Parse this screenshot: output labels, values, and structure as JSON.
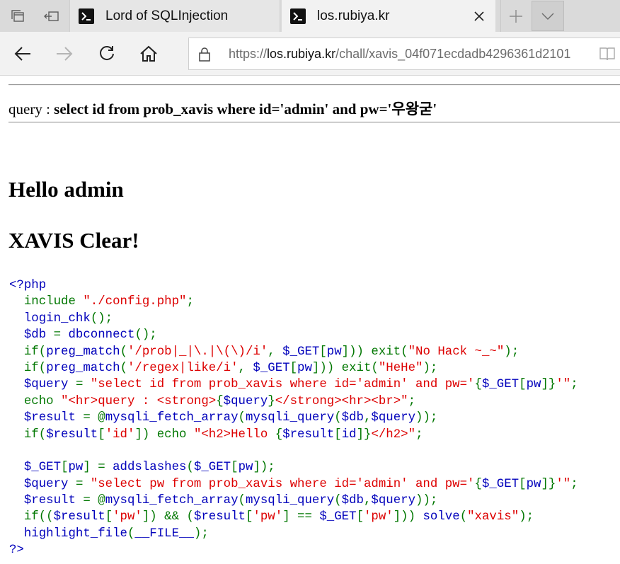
{
  "browser": {
    "tabs": [
      {
        "title": "Lord of SQLInjection",
        "active": false,
        "icon": "terminal-icon"
      },
      {
        "title": "los.rubiya.kr",
        "active": true,
        "icon": "terminal-icon"
      }
    ],
    "address": {
      "scheme": "https://",
      "host": "los.rubiya.kr",
      "path": "/chall/xavis_04f071ecdadb4296361d2101"
    }
  },
  "page": {
    "query_label": "query : ",
    "query_text": "select id from prob_xavis where id='admin' and pw='우왕굳'",
    "hello": "Hello admin",
    "clear": "XAVIS Clear!"
  },
  "colors": {
    "php_default": "#0000bb",
    "php_keyword": "#007700",
    "php_string": "#dd0000"
  },
  "source_code": [
    [
      [
        "d",
        "<?php"
      ]
    ],
    [
      [
        "k",
        "  include "
      ],
      [
        "s",
        "\"./config.php\""
      ],
      [
        "k",
        ";"
      ]
    ],
    [
      [
        "d",
        "  login_chk"
      ],
      [
        "k",
        "();"
      ]
    ],
    [
      [
        "d",
        "  $db "
      ],
      [
        "k",
        "= "
      ],
      [
        "d",
        "dbconnect"
      ],
      [
        "k",
        "();"
      ]
    ],
    [
      [
        "k",
        "  if("
      ],
      [
        "d",
        "preg_match"
      ],
      [
        "k",
        "("
      ],
      [
        "s",
        "'/prob|_|\\.|\\(\\)/i'"
      ],
      [
        "k",
        ", "
      ],
      [
        "d",
        "$_GET"
      ],
      [
        "k",
        "["
      ],
      [
        "d",
        "pw"
      ],
      [
        "k",
        "])) exit("
      ],
      [
        "s",
        "\"No Hack ~_~\""
      ],
      [
        "k",
        ");"
      ]
    ],
    [
      [
        "k",
        "  if("
      ],
      [
        "d",
        "preg_match"
      ],
      [
        "k",
        "("
      ],
      [
        "s",
        "'/regex|like/i'"
      ],
      [
        "k",
        ", "
      ],
      [
        "d",
        "$_GET"
      ],
      [
        "k",
        "["
      ],
      [
        "d",
        "pw"
      ],
      [
        "k",
        "])) exit("
      ],
      [
        "s",
        "\"HeHe\""
      ],
      [
        "k",
        ");"
      ]
    ],
    [
      [
        "d",
        "  $query "
      ],
      [
        "k",
        "= "
      ],
      [
        "s",
        "\"select id from prob_xavis where id='admin' and pw='"
      ],
      [
        "k",
        "{"
      ],
      [
        "d",
        "$_GET"
      ],
      [
        "k",
        "["
      ],
      [
        "d",
        "pw"
      ],
      [
        "k",
        "]}"
      ],
      [
        "s",
        "'\""
      ],
      [
        "k",
        ";"
      ]
    ],
    [
      [
        "k",
        "  echo "
      ],
      [
        "s",
        "\"<hr>query : <strong>"
      ],
      [
        "k",
        "{"
      ],
      [
        "d",
        "$query"
      ],
      [
        "k",
        "}"
      ],
      [
        "s",
        "</strong><hr><br>\""
      ],
      [
        "k",
        ";"
      ]
    ],
    [
      [
        "d",
        "  $result "
      ],
      [
        "k",
        "= @"
      ],
      [
        "d",
        "mysqli_fetch_array"
      ],
      [
        "k",
        "("
      ],
      [
        "d",
        "mysqli_query"
      ],
      [
        "k",
        "("
      ],
      [
        "d",
        "$db"
      ],
      [
        "k",
        ","
      ],
      [
        "d",
        "$query"
      ],
      [
        "k",
        "));"
      ]
    ],
    [
      [
        "k",
        "  if("
      ],
      [
        "d",
        "$result"
      ],
      [
        "k",
        "["
      ],
      [
        "s",
        "'id'"
      ],
      [
        "k",
        "]) echo "
      ],
      [
        "s",
        "\"<h2>Hello "
      ],
      [
        "k",
        "{"
      ],
      [
        "d",
        "$result"
      ],
      [
        "k",
        "["
      ],
      [
        "d",
        "id"
      ],
      [
        "k",
        "]}"
      ],
      [
        "s",
        "</h2>\""
      ],
      [
        "k",
        ";"
      ]
    ],
    [
      [
        "d",
        ""
      ]
    ],
    [
      [
        "d",
        "  $_GET"
      ],
      [
        "k",
        "["
      ],
      [
        "d",
        "pw"
      ],
      [
        "k",
        "] = "
      ],
      [
        "d",
        "addslashes"
      ],
      [
        "k",
        "("
      ],
      [
        "d",
        "$_GET"
      ],
      [
        "k",
        "["
      ],
      [
        "d",
        "pw"
      ],
      [
        "k",
        "]);"
      ]
    ],
    [
      [
        "d",
        "  $query "
      ],
      [
        "k",
        "= "
      ],
      [
        "s",
        "\"select pw from prob_xavis where id='admin' and pw='"
      ],
      [
        "k",
        "{"
      ],
      [
        "d",
        "$_GET"
      ],
      [
        "k",
        "["
      ],
      [
        "d",
        "pw"
      ],
      [
        "k",
        "]}"
      ],
      [
        "s",
        "'\""
      ],
      [
        "k",
        ";"
      ]
    ],
    [
      [
        "d",
        "  $result "
      ],
      [
        "k",
        "= @"
      ],
      [
        "d",
        "mysqli_fetch_array"
      ],
      [
        "k",
        "("
      ],
      [
        "d",
        "mysqli_query"
      ],
      [
        "k",
        "("
      ],
      [
        "d",
        "$db"
      ],
      [
        "k",
        ","
      ],
      [
        "d",
        "$query"
      ],
      [
        "k",
        "));"
      ]
    ],
    [
      [
        "k",
        "  if(("
      ],
      [
        "d",
        "$result"
      ],
      [
        "k",
        "["
      ],
      [
        "s",
        "'pw'"
      ],
      [
        "k",
        "]) && ("
      ],
      [
        "d",
        "$result"
      ],
      [
        "k",
        "["
      ],
      [
        "s",
        "'pw'"
      ],
      [
        "k",
        "] == "
      ],
      [
        "d",
        "$_GET"
      ],
      [
        "k",
        "["
      ],
      [
        "s",
        "'pw'"
      ],
      [
        "k",
        "])) "
      ],
      [
        "d",
        "solve"
      ],
      [
        "k",
        "("
      ],
      [
        "s",
        "\"xavis\""
      ],
      [
        "k",
        ");"
      ]
    ],
    [
      [
        "d",
        "  highlight_file"
      ],
      [
        "k",
        "("
      ],
      [
        "d",
        "__FILE__"
      ],
      [
        "k",
        ");"
      ]
    ],
    [
      [
        "d",
        "?>"
      ]
    ]
  ]
}
